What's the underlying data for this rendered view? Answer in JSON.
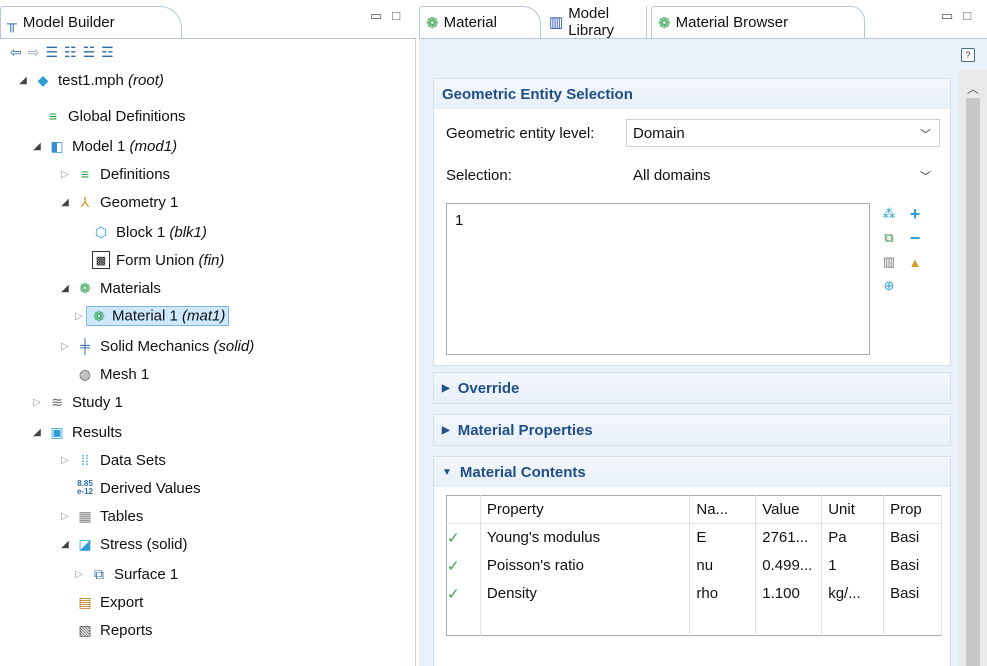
{
  "left_panel": {
    "tab_title": "Model Builder",
    "tree": [
      {
        "label": "test1.mph",
        "tag": "(root)",
        "arrow": "open"
      },
      {
        "label": "Global Definitions",
        "tag": "",
        "arrow": "none"
      },
      {
        "label": "Model 1",
        "tag": "(mod1)",
        "arrow": "open"
      },
      {
        "label": "Definitions",
        "tag": "",
        "arrow": "closed"
      },
      {
        "label": "Geometry 1",
        "tag": "",
        "arrow": "open"
      },
      {
        "label": "Block 1",
        "tag": "(blk1)",
        "arrow": "none"
      },
      {
        "label": "Form Union",
        "tag": "(fin)",
        "arrow": "none"
      },
      {
        "label": "Materials",
        "tag": "",
        "arrow": "open"
      },
      {
        "label": "Material 1",
        "tag": "(mat1)",
        "arrow": "closed",
        "selected": true
      },
      {
        "label": "Solid Mechanics",
        "tag": "(solid)",
        "arrow": "closed"
      },
      {
        "label": "Mesh 1",
        "tag": "",
        "arrow": "none"
      },
      {
        "label": "Study 1",
        "tag": "",
        "arrow": "closed"
      },
      {
        "label": "Results",
        "tag": "",
        "arrow": "open"
      },
      {
        "label": "Data Sets",
        "tag": "",
        "arrow": "closed"
      },
      {
        "label": "Derived Values",
        "tag": "",
        "arrow": "none"
      },
      {
        "label": "Tables",
        "tag": "",
        "arrow": "closed"
      },
      {
        "label": "Stress (solid)",
        "tag": "",
        "arrow": "open"
      },
      {
        "label": "Surface 1",
        "tag": "",
        "arrow": "closed"
      },
      {
        "label": "Export",
        "tag": "",
        "arrow": "none"
      },
      {
        "label": "Reports",
        "tag": "",
        "arrow": "none"
      }
    ]
  },
  "right_panel": {
    "tabs": {
      "material": "Material",
      "model_library": "Model Library",
      "material_browser": "Material Browser"
    },
    "geometric_entity_selection": {
      "title": "Geometric Entity Selection",
      "level_label": "Geometric entity level:",
      "level_value": "Domain",
      "selection_label": "Selection:",
      "selection_value": "All domains",
      "selected_items": "1"
    },
    "override": {
      "title": "Override"
    },
    "material_properties": {
      "title": "Material Properties"
    },
    "material_contents": {
      "title": "Material Contents",
      "columns": [
        "Property",
        "Na...",
        "Value",
        "Unit",
        "Prop"
      ],
      "rows": [
        {
          "property": "Young's modulus",
          "name": "E",
          "value": "2761...",
          "unit": "Pa",
          "group": "Basi"
        },
        {
          "property": "Poisson's ratio",
          "name": "nu",
          "value": "0.499...",
          "unit": "1",
          "group": "Basi"
        },
        {
          "property": "Density",
          "name": "rho",
          "value": "1.100",
          "unit": "kg/...",
          "group": "Basi"
        }
      ]
    }
  },
  "colors": {
    "section_header": "#1f4f86",
    "panel_bg": "#e9f1fa",
    "check": "#3aa24b",
    "selection": "#cde8ff"
  }
}
